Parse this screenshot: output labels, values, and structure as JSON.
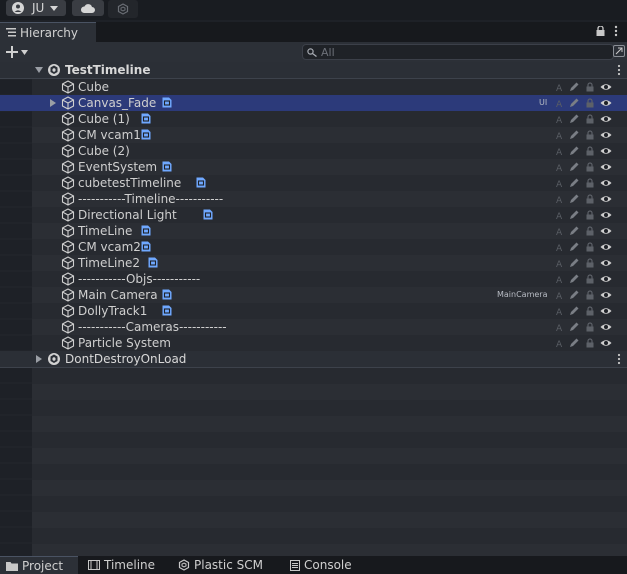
{
  "topbar": {
    "account_label": "JU",
    "account_icon": "account-icon",
    "cloud_icon": "cloud-icon",
    "collab_icon": "collab-icon"
  },
  "hierarchy": {
    "tab_label": "Hierarchy",
    "tab_icon": "list-icon",
    "search_placeholder": "All"
  },
  "scenes": [
    {
      "name": "TestTimeline",
      "expanded": true
    },
    {
      "name": "DontDestroyOnLoad",
      "expanded": false
    }
  ],
  "objects": [
    {
      "name": "Cube",
      "prefab": false,
      "tag": ""
    },
    {
      "name": "Canvas_Fade",
      "prefab": true,
      "tag": "UI",
      "selected": true,
      "has_children": true
    },
    {
      "name": "Cube (1)",
      "prefab": true,
      "tag": ""
    },
    {
      "name": "CM vcam1",
      "prefab": true,
      "tag": ""
    },
    {
      "name": "Cube (2)",
      "prefab": false,
      "tag": ""
    },
    {
      "name": "EventSystem",
      "prefab": true,
      "tag": ""
    },
    {
      "name": "cubetestTimeline",
      "prefab": true,
      "tag": ""
    },
    {
      "name": "-----------Timeline-----------",
      "prefab": false,
      "tag": ""
    },
    {
      "name": "Directional Light",
      "prefab": true,
      "tag": ""
    },
    {
      "name": "TimeLine",
      "prefab": true,
      "tag": ""
    },
    {
      "name": "CM vcam2",
      "prefab": true,
      "tag": ""
    },
    {
      "name": "TimeLine2",
      "prefab": true,
      "tag": ""
    },
    {
      "name": "-----------Objs-----------",
      "prefab": false,
      "tag": ""
    },
    {
      "name": "Main Camera",
      "prefab": true,
      "tag": "MainCamera"
    },
    {
      "name": "DollyTrack1",
      "prefab": true,
      "tag": ""
    },
    {
      "name": "-----------Cameras-----------",
      "prefab": false,
      "tag": ""
    },
    {
      "name": "Particle System",
      "prefab": false,
      "tag": ""
    }
  ],
  "bottom_tabs": [
    {
      "label": "Project",
      "icon": "folder-icon"
    },
    {
      "label": "Timeline",
      "icon": "film-icon"
    },
    {
      "label": "Plastic SCM",
      "icon": "plastic-icon"
    },
    {
      "label": "Console",
      "icon": "console-icon"
    }
  ]
}
